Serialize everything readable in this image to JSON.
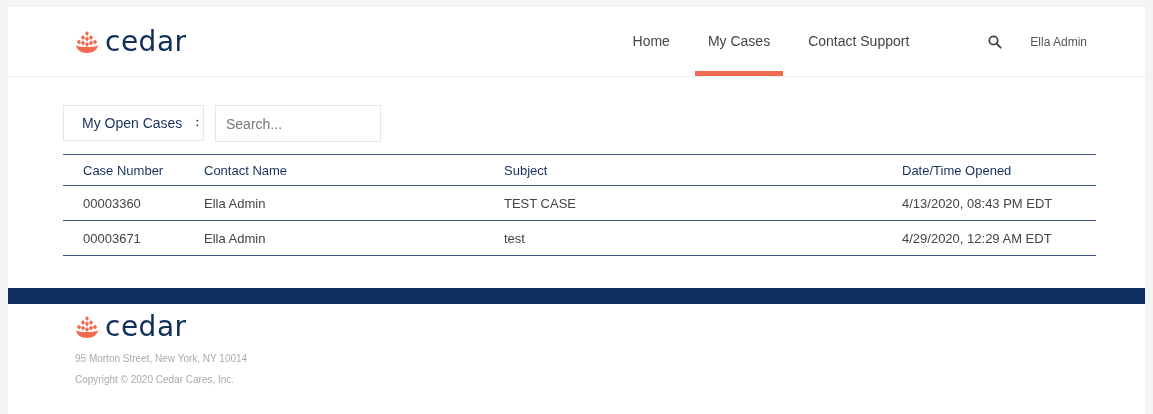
{
  "header": {
    "logo": "cedar",
    "nav": [
      {
        "label": "Home",
        "selected": false
      },
      {
        "label": "My Cases",
        "selected": true
      },
      {
        "label": "Contact Support",
        "selected": false
      }
    ],
    "user": "Ella Admin"
  },
  "filters": {
    "list_view": "My Open Cases",
    "search": {
      "placeholder": "Search..."
    }
  },
  "table": {
    "columns": [
      "Case Number",
      "Contact Name",
      "Subject",
      "Date/Time Opened"
    ],
    "rows": [
      [
        "00003360",
        "Ella Admin",
        "TEST CASE",
        "4/13/2020, 08:43 PM EDT"
      ],
      [
        "00003671",
        "Ella Admin",
        "test",
        "4/29/2020, 12:29 AM EDT"
      ]
    ]
  },
  "footer": {
    "logo": "cedar",
    "address": "95 Morton Street, New York, NY 10014",
    "copyright": "Copyright © 2020 Cedar Cares, Inc."
  }
}
